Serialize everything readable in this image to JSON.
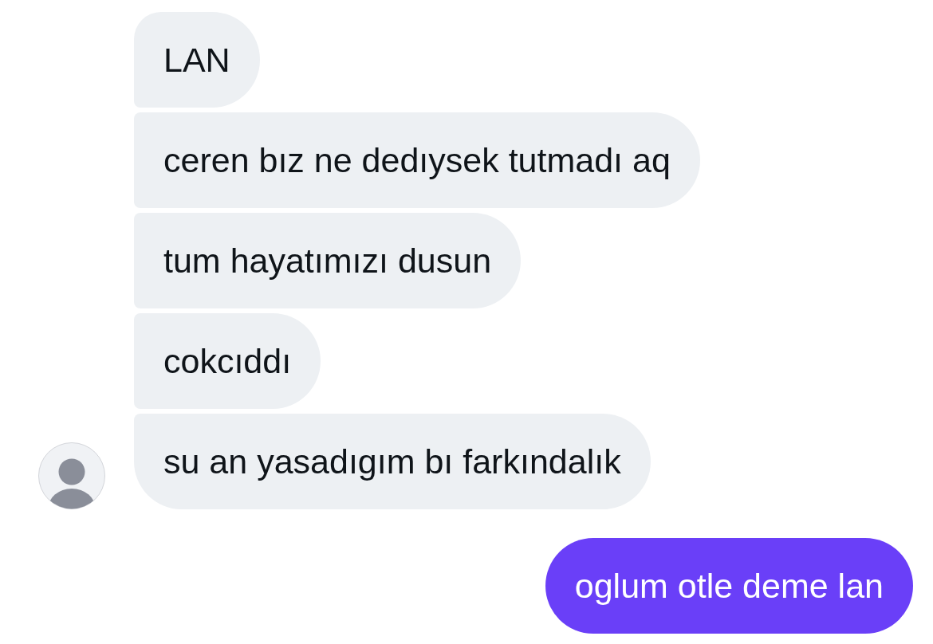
{
  "messages": [
    {
      "kind": "received",
      "text": "LAN"
    },
    {
      "kind": "received",
      "text": "ceren bız ne dedıysek tutmadı aq"
    },
    {
      "kind": "received",
      "text": "tum hayatımızı dusun"
    },
    {
      "kind": "received",
      "text": "cokcıddı"
    },
    {
      "kind": "received",
      "text": "su an yasadıgım bı farkındalık"
    },
    {
      "kind": "sent",
      "text": "oglum otle deme lan"
    }
  ]
}
